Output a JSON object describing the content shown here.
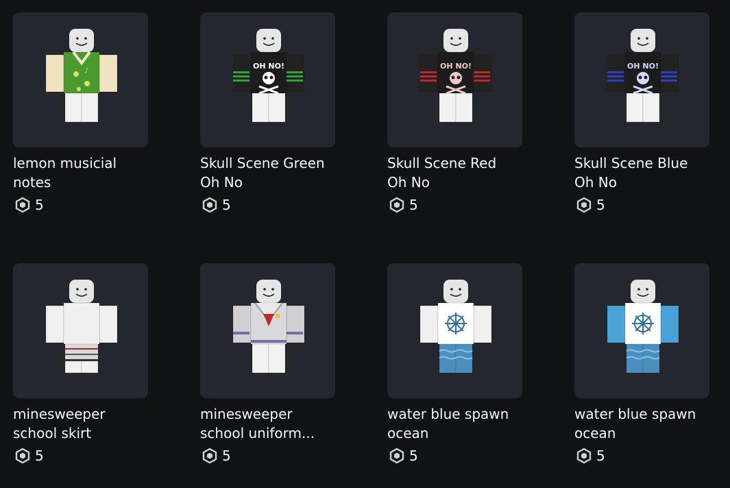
{
  "items": [
    {
      "name": "lemon musicial\nnotes",
      "price": "5",
      "shirt": {
        "body": "#4b9a2d",
        "sleeve": "#efe3c0",
        "trim": "#f2e9cc",
        "accent": "#d7e36a",
        "pattern": "lemon"
      }
    },
    {
      "name": "Skull Scene Green\nOh No",
      "price": "5",
      "shirt": {
        "body": "#1c1c1c",
        "sleeve": "#222222",
        "trim": "#2fa43b",
        "accent": "#ffffff",
        "pattern": "skull",
        "label": "OH NO!"
      }
    },
    {
      "name": "Skull Scene Red\nOh No",
      "price": "5",
      "shirt": {
        "body": "#1c1c1c",
        "sleeve": "#222222",
        "trim": "#c0272d",
        "accent": "#f0c8c8",
        "pattern": "skull",
        "label": "OH NO!"
      }
    },
    {
      "name": "Skull Scene Blue\nOh No",
      "price": "5",
      "shirt": {
        "body": "#1c1c1c",
        "sleeve": "#222222",
        "trim": "#2f3fc4",
        "accent": "#d5d8ff",
        "pattern": "skull",
        "label": "OH NO!"
      }
    },
    {
      "name": "minesweeper\nschool skirt",
      "price": "5",
      "shirt": {
        "body": "#f0f0f0",
        "sleeve": "#f0f0f0",
        "trim": "#c8c8c8",
        "accent": "#555555",
        "pattern": "skirt"
      }
    },
    {
      "name": "minesweeper\nschool uniform...",
      "price": "5",
      "shirt": {
        "body": "#d9d9dc",
        "sleeve": "#cfcfd4",
        "trim": "#6f6fa8",
        "accent": "#c8252b",
        "pattern": "uniform"
      }
    },
    {
      "name": "water blue spawn\nocean",
      "price": "5",
      "shirt": {
        "body": "#ffffff",
        "sleeve": "#f0f0f0",
        "trim": "#3a86b8",
        "accent": "#2f6f9a",
        "pattern": "spawn"
      }
    },
    {
      "name": "water blue spawn\nocean",
      "price": "5",
      "shirt": {
        "body": "#ffffff",
        "sleeve": "#4aa3d8",
        "trim": "#3a86b8",
        "accent": "#2f6f9a",
        "pattern": "spawn-sleeves"
      }
    }
  ],
  "icons": {
    "currency": "robux-icon"
  },
  "colors": {
    "background": "#111214",
    "card": "#24272d",
    "text": "#f7f7f8"
  }
}
